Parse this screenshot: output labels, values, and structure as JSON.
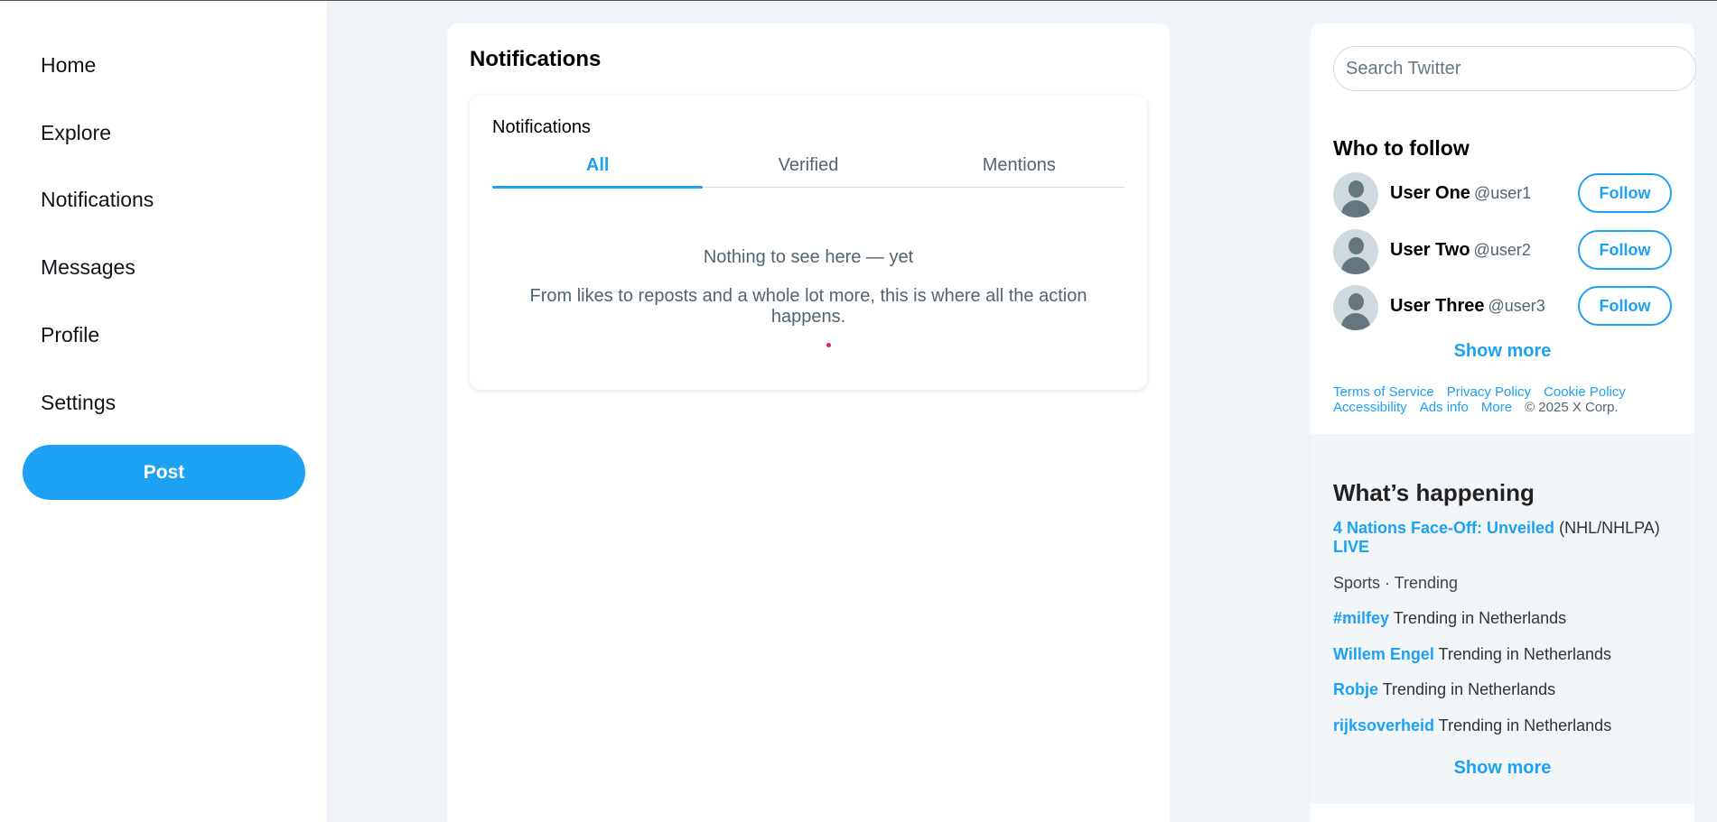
{
  "sidebar": {
    "items": [
      {
        "label": "Home"
      },
      {
        "label": "Explore"
      },
      {
        "label": "Notifications"
      },
      {
        "label": "Messages"
      },
      {
        "label": "Profile"
      },
      {
        "label": "Settings"
      }
    ],
    "post_label": "Post"
  },
  "main": {
    "title": "Notifications",
    "card_label": "Notifications",
    "tabs": [
      {
        "label": "All",
        "active": true
      },
      {
        "label": "Verified",
        "active": false
      },
      {
        "label": "Mentions",
        "active": false
      }
    ],
    "empty_title": "Nothing to see here — yet",
    "empty_text": "From likes to reposts and a whole lot more, this is where all the action happens."
  },
  "right": {
    "search": {
      "placeholder": "Search Twitter",
      "value": ""
    },
    "who_to_follow": {
      "title": "Who to follow",
      "users": [
        {
          "name": "User One",
          "handle": "@user1",
          "button": "Follow"
        },
        {
          "name": "User Two",
          "handle": "@user2",
          "button": "Follow"
        },
        {
          "name": "User Three",
          "handle": "@user3",
          "button": "Follow"
        }
      ],
      "show_more": "Show more"
    },
    "footer": {
      "links": [
        "Terms of Service",
        "Privacy Policy",
        "Cookie Policy",
        "Accessibility",
        "Ads info",
        "More"
      ],
      "copyright": "© 2025 X Corp."
    },
    "happening": {
      "title": "What’s happening",
      "trends": [
        {
          "tag": "4 Nations Face-Off: Unveiled",
          "suffix": "(NHL/NHLPA)",
          "live": "LIVE"
        },
        {
          "meta": "Sports · Trending"
        },
        {
          "tag": "#milfey",
          "suffix": "Trending in Netherlands"
        },
        {
          "tag": "Willem Engel",
          "suffix": "Trending in Netherlands"
        },
        {
          "tag": "Robje",
          "suffix": "Trending in Netherlands"
        },
        {
          "tag": "rijksoverheid",
          "suffix": "Trending in Netherlands"
        }
      ],
      "show_more": "Show more"
    }
  },
  "colors": {
    "accent": "#1da1f2",
    "background": "#f0f3f7"
  }
}
